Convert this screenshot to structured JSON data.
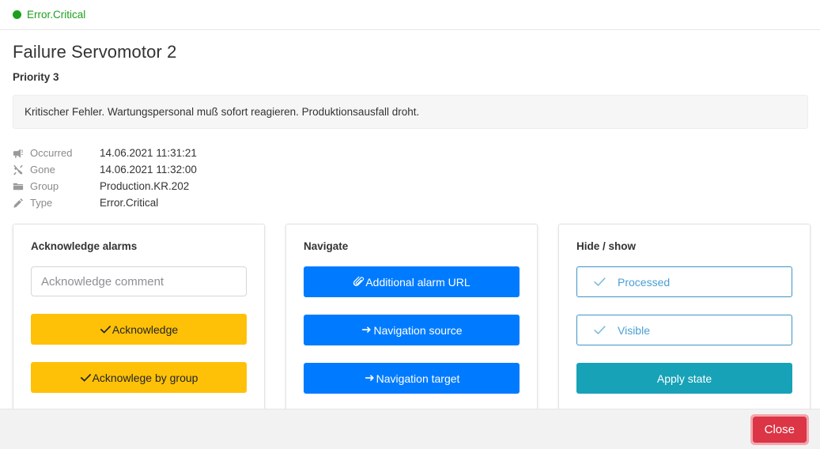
{
  "header": {
    "status_label": "Error.Critical",
    "status_color": "#1ca01c",
    "status_icon": "circle-filled-icon"
  },
  "alarm": {
    "title": "Failure Servomotor 2",
    "priority": "Priority 3",
    "description": "Kritischer Fehler. Wartungspersonal muß sofort reagieren. Produktionsausfall droht.",
    "meta": [
      {
        "icon": "bullhorn-icon",
        "label": "Occurred",
        "value": "14.06.2021 11:31:21"
      },
      {
        "icon": "tools-icon",
        "label": "Gone",
        "value": "14.06.2021 11:32:00"
      },
      {
        "icon": "folder-icon",
        "label": "Group",
        "value": "Production.KR.202"
      },
      {
        "icon": "pencil-icon",
        "label": "Type",
        "value": "Error.Critical"
      }
    ]
  },
  "cards": {
    "acknowledge": {
      "title": "Acknowledge alarms",
      "comment_value": "",
      "comment_placeholder": "Acknowledge comment",
      "buttons": [
        {
          "label": "Acknowledge",
          "icon": "check-icon",
          "color": "#ffc107"
        },
        {
          "label": "Acknowlege by group",
          "icon": "check-icon",
          "color": "#ffc107"
        }
      ]
    },
    "navigate": {
      "title": "Navigate",
      "buttons": [
        {
          "label": "Additional alarm URL",
          "icon": "paperclip-icon",
          "color": "#007bff"
        },
        {
          "label": "Navigation source",
          "icon": "arrow-right-icon",
          "color": "#007bff"
        },
        {
          "label": "Navigation target",
          "icon": "arrow-right-icon",
          "color": "#007bff"
        }
      ]
    },
    "hideshow": {
      "title": "Hide / show",
      "toggles": [
        {
          "label": "Processed",
          "icon": "check-icon",
          "checked": true
        },
        {
          "label": "Visible",
          "icon": "check-icon",
          "checked": true
        }
      ],
      "apply_label": "Apply state",
      "apply_color": "#17a2b8"
    }
  },
  "footer": {
    "close_label": "Close",
    "close_color": "#dc3545"
  }
}
